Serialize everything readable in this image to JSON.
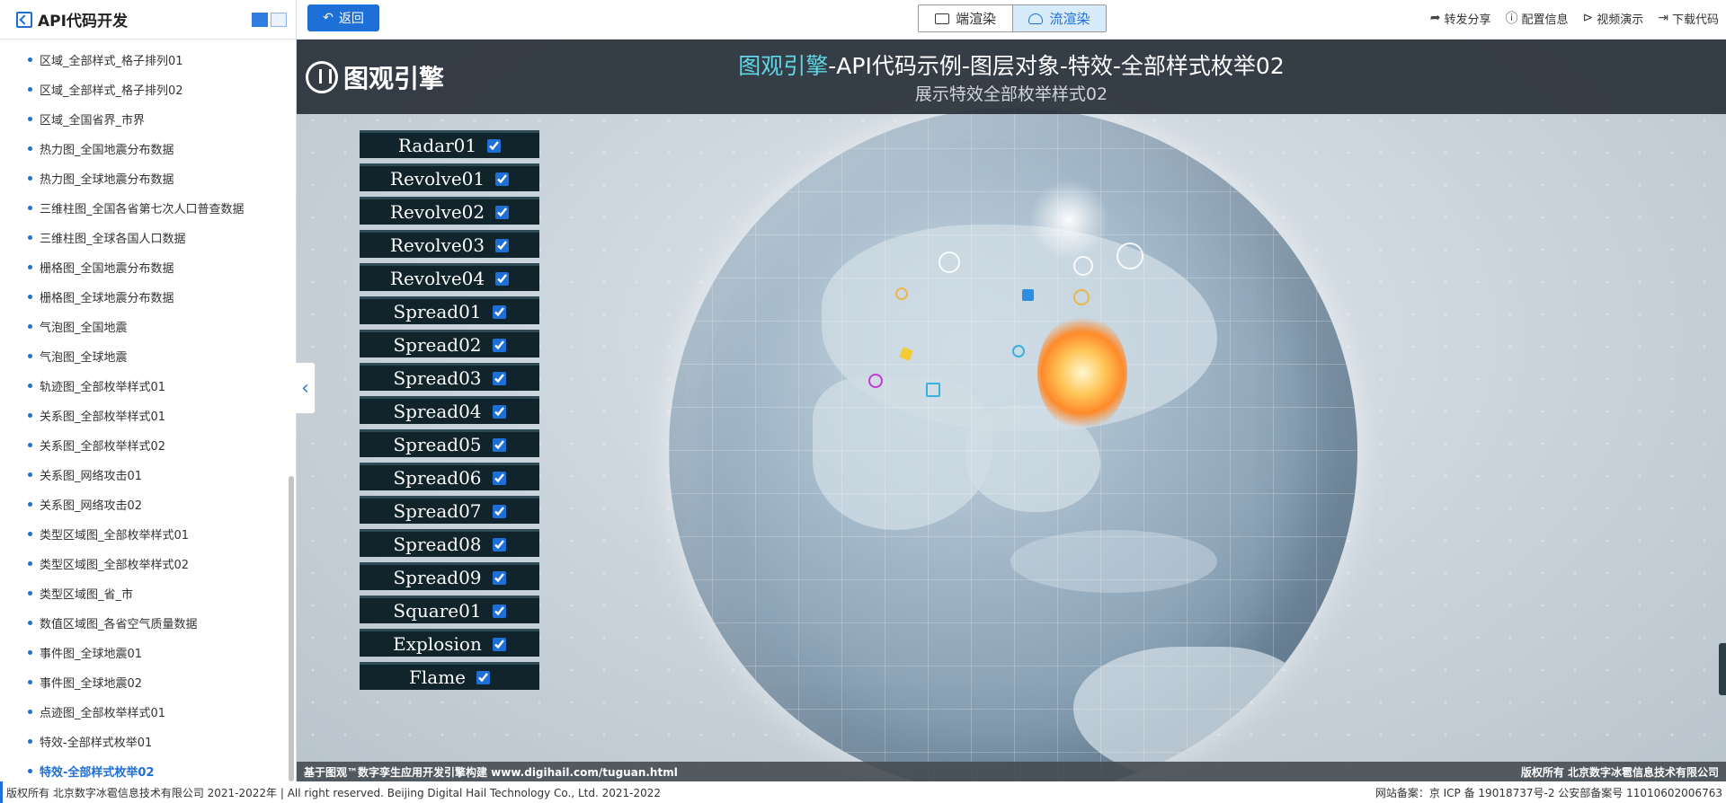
{
  "sidebar": {
    "title": "API代码开发",
    "items": [
      {
        "label": "区域_全部样式_格子排列01",
        "active": false
      },
      {
        "label": "区域_全部样式_格子排列02",
        "active": false
      },
      {
        "label": "区域_全国省界_市界",
        "active": false
      },
      {
        "label": "热力图_全国地震分布数据",
        "active": false
      },
      {
        "label": "热力图_全球地震分布数据",
        "active": false
      },
      {
        "label": "三维柱图_全国各省第七次人口普查数据",
        "active": false
      },
      {
        "label": "三维柱图_全球各国人口数据",
        "active": false
      },
      {
        "label": "栅格图_全国地震分布数据",
        "active": false
      },
      {
        "label": "栅格图_全球地震分布数据",
        "active": false
      },
      {
        "label": "气泡图_全国地震",
        "active": false
      },
      {
        "label": "气泡图_全球地震",
        "active": false
      },
      {
        "label": "轨迹图_全部枚举样式01",
        "active": false
      },
      {
        "label": "关系图_全部枚举样式01",
        "active": false
      },
      {
        "label": "关系图_全部枚举样式02",
        "active": false
      },
      {
        "label": "关系图_网络攻击01",
        "active": false
      },
      {
        "label": "关系图_网络攻击02",
        "active": false
      },
      {
        "label": "类型区域图_全部枚举样式01",
        "active": false
      },
      {
        "label": "类型区域图_全部枚举样式02",
        "active": false
      },
      {
        "label": "类型区域图_省_市",
        "active": false
      },
      {
        "label": "数值区域图_各省空气质量数据",
        "active": false
      },
      {
        "label": "事件图_全球地震01",
        "active": false
      },
      {
        "label": "事件图_全球地震02",
        "active": false
      },
      {
        "label": "点迹图_全部枚举样式01",
        "active": false
      },
      {
        "label": "特效-全部样式枚举01",
        "active": false
      },
      {
        "label": "特效-全部样式枚举02",
        "active": true
      }
    ]
  },
  "topbar": {
    "back_label": "返回",
    "render_client": "端渲染",
    "render_stream": "流渲染",
    "links": [
      "转发分享",
      "配置信息",
      "视频演示",
      "下载代码"
    ]
  },
  "scene": {
    "logo_text": "图观引擎",
    "title_accent": "图观引擎",
    "title_rest": "-API代码示例-图层对象-特效-全部样式枚举02",
    "subtitle": "展示特效全部枚举样式02",
    "layers": [
      {
        "name": "Radar01",
        "checked": true
      },
      {
        "name": "Revolve01",
        "checked": true
      },
      {
        "name": "Revolve02",
        "checked": true
      },
      {
        "name": "Revolve03",
        "checked": true
      },
      {
        "name": "Revolve04",
        "checked": true
      },
      {
        "name": "Spread01",
        "checked": true
      },
      {
        "name": "Spread02",
        "checked": true
      },
      {
        "name": "Spread03",
        "checked": true
      },
      {
        "name": "Spread04",
        "checked": true
      },
      {
        "name": "Spread05",
        "checked": true
      },
      {
        "name": "Spread06",
        "checked": true
      },
      {
        "name": "Spread07",
        "checked": true
      },
      {
        "name": "Spread08",
        "checked": true
      },
      {
        "name": "Spread09",
        "checked": true
      },
      {
        "name": "Square01",
        "checked": true
      },
      {
        "name": "Explosion",
        "checked": true
      },
      {
        "name": "Flame",
        "checked": true
      }
    ],
    "footer_left": "基于图观™数字孪生应用开发引擎构建 www.digihail.com/tuguan.html",
    "footer_right": "版权所有 北京数字冰雹信息技术有限公司"
  },
  "page_footer": {
    "left": "版权所有 北京数字冰雹信息技术有限公司 2021-2022年 | All right reserved. Beijing Digital Hail Technology Co., Ltd. 2021-2022",
    "right": "网站备案：京 ICP 备 19018737号-2 公安部备案号 11010602006763"
  },
  "colors": {
    "accent": "#1e6fd6",
    "title_accent": "#5fd7e6",
    "panel_bg": "#11242c"
  }
}
